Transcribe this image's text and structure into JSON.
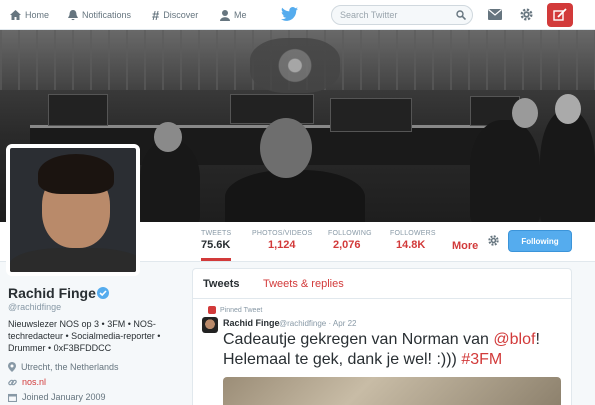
{
  "nav": {
    "home": "Home",
    "notifications": "Notifications",
    "discover": "Discover",
    "me": "Me",
    "search_placeholder": "Search Twitter"
  },
  "stats": [
    {
      "label": "TWEETS",
      "value": "75.6K"
    },
    {
      "label": "PHOTOS/VIDEOS",
      "value": "1,124"
    },
    {
      "label": "FOLLOWING",
      "value": "2,076"
    },
    {
      "label": "FOLLOWERS",
      "value": "14.8K"
    }
  ],
  "more_label": "More",
  "follow_label": "Following",
  "profile": {
    "name": "Rachid Finge",
    "handle": "@rachidfinge",
    "bio": "Nieuwslezer NOS op 3 • 3FM • NOS-techredacteur • Socialmedia-reporter • Drummer • 0xF3BFDDCC",
    "location": "Utrecht, the Netherlands",
    "website": "nos.nl",
    "joined": "Joined January 2009"
  },
  "timeline": {
    "tab_tweets": "Tweets",
    "tab_replies": "Tweets & replies",
    "pinned_label": "Pinned Tweet",
    "tweet": {
      "author": "Rachid Finge",
      "handle_date": "@rachidfinge · Apr 22",
      "text_part1": "Cadeautje gekregen van Norman van ",
      "mention": "@blof",
      "text_part2": "! Helemaal te gek, dank je wel! :))) ",
      "hashtag": "#3FM"
    }
  },
  "colors": {
    "accent": "#d23a3a",
    "follow_button": "#55acee"
  }
}
